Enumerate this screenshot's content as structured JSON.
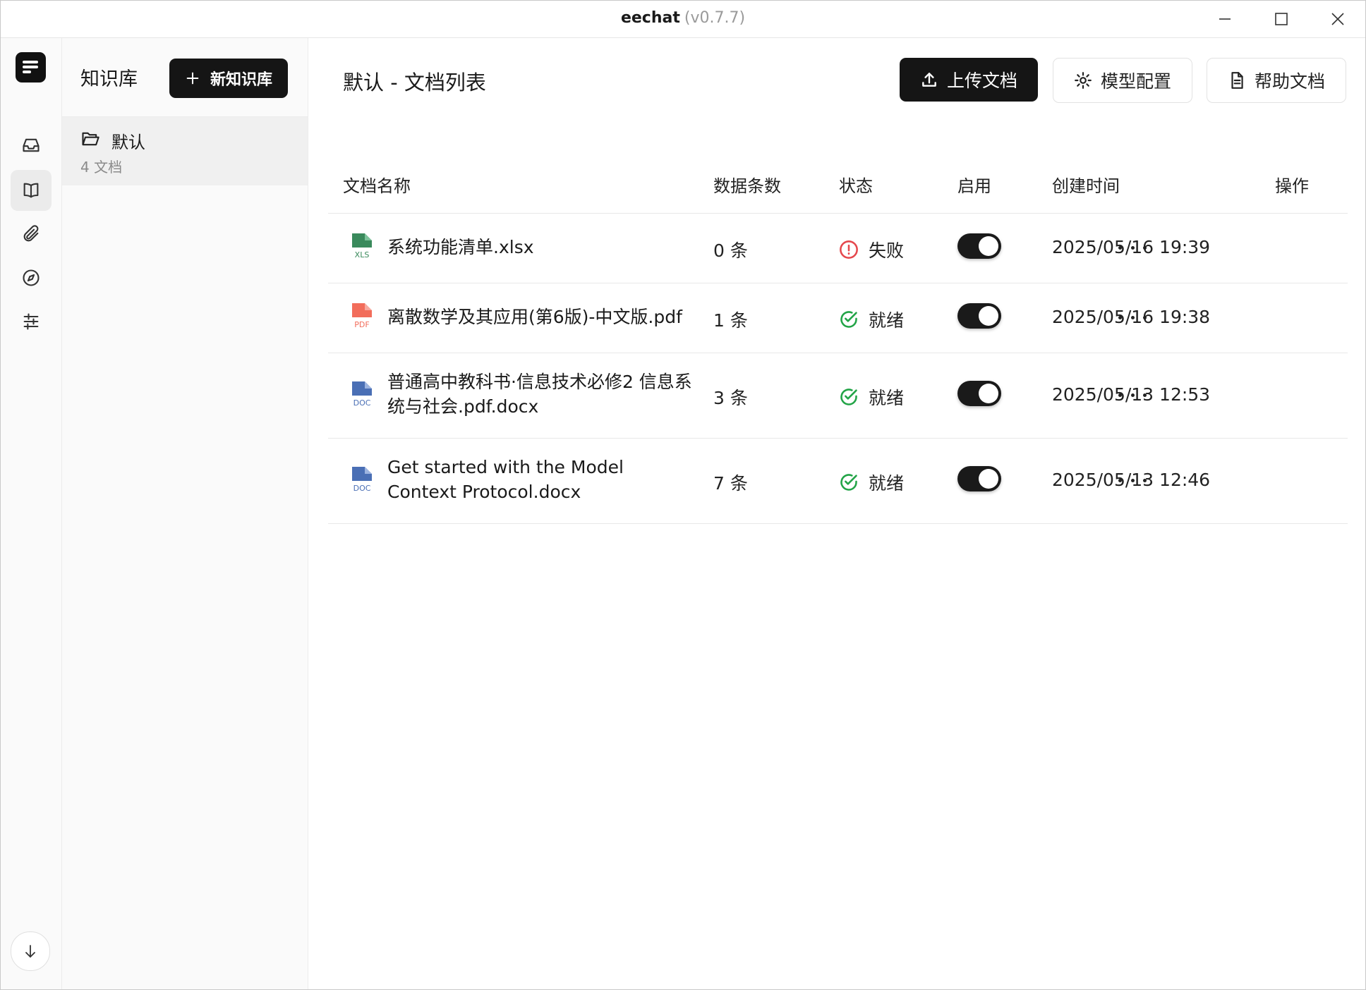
{
  "window": {
    "app_name": "eechat",
    "version": "(v0.7.7)"
  },
  "sidebar": {
    "title": "知识库",
    "new_button": "新知识库",
    "items": [
      {
        "name": "默认",
        "count": "4 文档"
      }
    ]
  },
  "main": {
    "title": "默认 - 文档列表",
    "buttons": {
      "upload": "上传文档",
      "model_config": "模型配置",
      "help": "帮助文档"
    },
    "columns": {
      "name": "文档名称",
      "records": "数据条数",
      "status": "状态",
      "enabled": "启用",
      "created": "创建时间",
      "actions": "操作"
    },
    "rows": [
      {
        "name": "系统功能清单.xlsx",
        "type": "XLS",
        "records": "0 条",
        "status": "失败",
        "enabled": true,
        "created": "2025/05/16 19:39"
      },
      {
        "name": "离散数学及其应用(第6版)-中文版.pdf",
        "type": "PDF",
        "records": "1 条",
        "status": "就绪",
        "enabled": true,
        "created": "2025/05/16 19:38"
      },
      {
        "name": "普通高中教科书·信息技术必修2 信息系统与社会.pdf.docx",
        "type": "DOC",
        "records": "3 条",
        "status": "就绪",
        "enabled": true,
        "created": "2025/05/13 12:53"
      },
      {
        "name": "Get started with the Model Context Protocol.docx",
        "type": "DOC",
        "records": "7 条",
        "status": "就绪",
        "enabled": true,
        "created": "2025/05/13 12:46"
      }
    ]
  },
  "colors": {
    "accent": "#151515",
    "success": "#22a447",
    "error": "#e5484d",
    "xls": "#3a8a5c",
    "pdf": "#f26d5b",
    "doc": "#4a6fb5"
  },
  "icons": {
    "rail": [
      "inbox-icon",
      "book-icon",
      "paperclip-icon",
      "compass-icon",
      "sliders-icon",
      "arrow-down-icon"
    ],
    "buttons": [
      "plus-icon",
      "upload-icon",
      "gear-icon",
      "document-icon"
    ],
    "status": {
      "failed": "alert-circle-icon",
      "ready": "check-circle-icon"
    }
  }
}
